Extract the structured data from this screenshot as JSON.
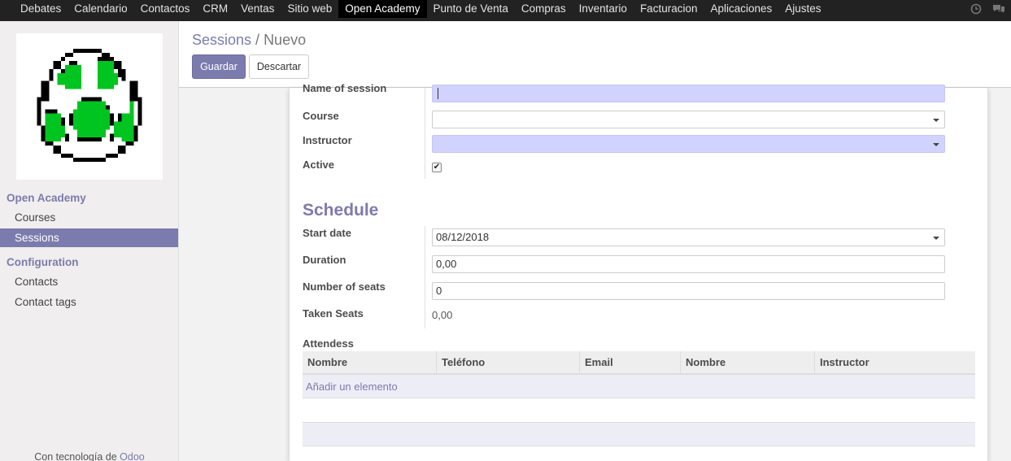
{
  "topbar": {
    "menu": [
      {
        "label": "Debates",
        "name": "menu-debates"
      },
      {
        "label": "Calendario",
        "name": "menu-calendario"
      },
      {
        "label": "Contactos",
        "name": "menu-contactos"
      },
      {
        "label": "CRM",
        "name": "menu-crm"
      },
      {
        "label": "Ventas",
        "name": "menu-ventas"
      },
      {
        "label": "Sitio web",
        "name": "menu-sitio-web"
      },
      {
        "label": "Open Academy",
        "name": "menu-open-academy",
        "active": true
      },
      {
        "label": "Punto de Venta",
        "name": "menu-punto-de-venta"
      },
      {
        "label": "Compras",
        "name": "menu-compras"
      },
      {
        "label": "Inventario",
        "name": "menu-inventario"
      },
      {
        "label": "Facturacion",
        "name": "menu-facturacion"
      },
      {
        "label": "Aplicaciones",
        "name": "menu-aplicaciones"
      },
      {
        "label": "Ajustes",
        "name": "menu-ajustes"
      }
    ],
    "icons": [
      "clock-icon",
      "chat-icon"
    ]
  },
  "sidebar": {
    "section1": "Open Academy",
    "items1": [
      "Courses",
      "Sessions"
    ],
    "active_item": "Sessions",
    "section2": "Configuration",
    "items2": [
      "Contacts",
      "Contact tags"
    ],
    "powered_prefix": "Con tecnología de ",
    "powered_brand": "Odoo"
  },
  "control": {
    "breadcrumb_parent": "Sessions",
    "breadcrumb_sep": " / ",
    "breadcrumb_current": "Nuevo",
    "save_label": "Guardar",
    "discard_label": "Descartar"
  },
  "form": {
    "name_label": "Name of session",
    "name_value": "",
    "course_label": "Course",
    "course_value": "",
    "instructor_label": "Instructor",
    "instructor_value": "",
    "active_label": "Active",
    "active_checked": true,
    "schedule_heading": "Schedule",
    "start_date_label": "Start date",
    "start_date_value": "08/12/2018",
    "duration_label": "Duration",
    "duration_value": "0,00",
    "seats_label": "Number of seats",
    "seats_value": "0",
    "taken_seats_label": "Taken Seats",
    "taken_seats_value": "0,00",
    "attendees_label": "Attendess",
    "attendees_columns": [
      "Nombre",
      "Teléfono",
      "Email",
      "Nombre",
      "Instructor"
    ],
    "add_line_label": "Añadir un elemento"
  },
  "colors": {
    "brand": "#7c7bad",
    "required_field": "#d2d2ff",
    "topbar": "#222222"
  }
}
